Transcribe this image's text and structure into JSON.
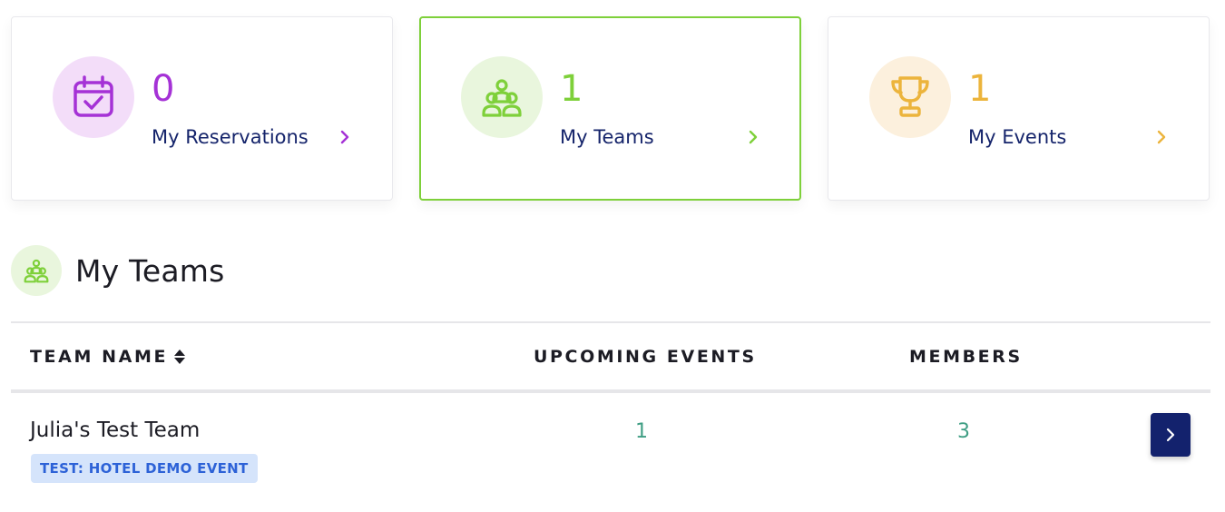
{
  "cards": [
    {
      "count": "0",
      "label": "My Reservations",
      "icon": "calendar-check-icon",
      "color": "#a532d6",
      "circle_bg": "#f3ddf9",
      "active": false
    },
    {
      "count": "1",
      "label": "My Teams",
      "icon": "team-icon",
      "color": "#7ed03a",
      "circle_bg": "#e9f6dd",
      "active": true
    },
    {
      "count": "1",
      "label": "My Events",
      "icon": "trophy-icon",
      "color": "#ecb43c",
      "circle_bg": "#fcf0dd",
      "active": false
    }
  ],
  "section": {
    "title": "My Teams",
    "icon": "team-icon"
  },
  "table": {
    "columns": [
      "TEAM NAME",
      "UPCOMING EVENTS",
      "MEMBERS"
    ],
    "rows": [
      {
        "name": "Julia's Test Team",
        "badge": "TEST: HOTEL DEMO EVENT",
        "upcoming_events": "1",
        "members": "3"
      }
    ]
  },
  "colors": {
    "primary_navy": "#13226d",
    "teal_value": "#3f9e84"
  }
}
